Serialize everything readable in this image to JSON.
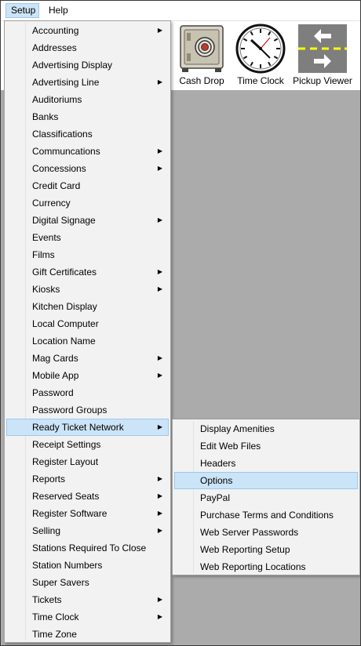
{
  "menubar": {
    "setup": "Setup",
    "help": "Help"
  },
  "toolbar": [
    {
      "label": "Cash Drop",
      "icon": "safe-icon"
    },
    {
      "label": "Time Clock",
      "icon": "clock-icon"
    },
    {
      "label": "Pickup Viewer",
      "icon": "road-arrows-icon"
    }
  ],
  "setup_menu": {
    "items": [
      {
        "label": "Accounting",
        "submenu": true
      },
      {
        "label": "Addresses",
        "submenu": false
      },
      {
        "label": "Advertising Display",
        "submenu": false
      },
      {
        "label": "Advertising Line",
        "submenu": true
      },
      {
        "label": "Auditoriums",
        "submenu": false
      },
      {
        "label": "Banks",
        "submenu": false
      },
      {
        "label": "Classifications",
        "submenu": false
      },
      {
        "label": "Communcations",
        "submenu": true
      },
      {
        "label": "Concessions",
        "submenu": true
      },
      {
        "label": "Credit Card",
        "submenu": false
      },
      {
        "label": "Currency",
        "submenu": false
      },
      {
        "label": "Digital Signage",
        "submenu": true
      },
      {
        "label": "Events",
        "submenu": false
      },
      {
        "label": "Films",
        "submenu": false
      },
      {
        "label": "Gift Certificates",
        "submenu": true
      },
      {
        "label": "Kiosks",
        "submenu": true
      },
      {
        "label": "Kitchen Display",
        "submenu": false
      },
      {
        "label": "Local Computer",
        "submenu": false
      },
      {
        "label": "Location Name",
        "submenu": false
      },
      {
        "label": "Mag Cards",
        "submenu": true
      },
      {
        "label": "Mobile App",
        "submenu": true
      },
      {
        "label": "Password",
        "submenu": false
      },
      {
        "label": "Password Groups",
        "submenu": false
      },
      {
        "label": "Ready Ticket Network",
        "submenu": true,
        "highlighted": true
      },
      {
        "label": "Receipt Settings",
        "submenu": false
      },
      {
        "label": "Register Layout",
        "submenu": false
      },
      {
        "label": "Reports",
        "submenu": true
      },
      {
        "label": "Reserved Seats",
        "submenu": true
      },
      {
        "label": "Register Software",
        "submenu": true
      },
      {
        "label": "Selling",
        "submenu": true
      },
      {
        "label": "Stations Required To Close",
        "submenu": false
      },
      {
        "label": "Station Numbers",
        "submenu": false
      },
      {
        "label": "Super Savers",
        "submenu": false
      },
      {
        "label": "Tickets",
        "submenu": true
      },
      {
        "label": "Time Clock",
        "submenu": true
      },
      {
        "label": "Time Zone",
        "submenu": false
      }
    ]
  },
  "ready_ticket_menu": {
    "items": [
      {
        "label": "Display Amenities",
        "highlighted": false
      },
      {
        "label": "Edit Web Files",
        "highlighted": false
      },
      {
        "label": "Headers",
        "highlighted": false
      },
      {
        "label": "Options",
        "highlighted": true
      },
      {
        "label": "PayPal",
        "highlighted": false
      },
      {
        "label": "Purchase Terms and Conditions",
        "highlighted": false
      },
      {
        "label": "Web Server Passwords",
        "highlighted": false
      },
      {
        "label": "Web Reporting Setup",
        "highlighted": false
      },
      {
        "label": "Web Reporting Locations",
        "highlighted": false
      }
    ]
  },
  "colors": {
    "menu_highlight": "#cce4f7",
    "menu_highlight_border": "#99c9ef",
    "workspace": "#ababab",
    "toolbar_icon_accent": "#ffff00"
  }
}
